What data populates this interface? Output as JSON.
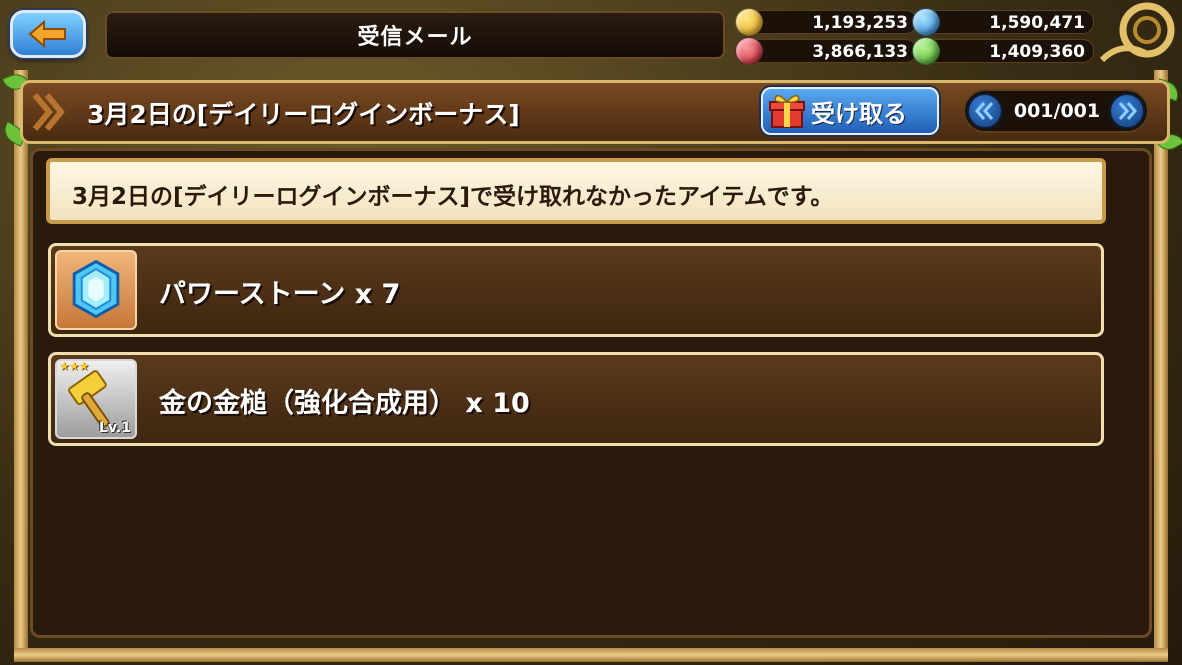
{
  "header": {
    "back_icon": "left-arrow-icon",
    "screen_title": "受信メール"
  },
  "currencies": [
    {
      "icon": "gold-coin-icon",
      "color": "#f2b722",
      "value": "1,193,253"
    },
    {
      "icon": "blue-stone-icon",
      "color": "#2f9be8",
      "value": "1,590,471"
    },
    {
      "icon": "red-orb-icon",
      "color": "#d63040",
      "value": "3,866,133"
    },
    {
      "icon": "green-orb-icon",
      "color": "#4cc030",
      "value": "1,409,360"
    }
  ],
  "mail": {
    "title": "3月2日の[デイリーログインボーナス]",
    "receive_label": "受け取る",
    "receive_icon": "gift-box-icon",
    "page_indicator": "001/001",
    "message": "3月2日の[デイリーログインボーナス]で受け取れなかったアイテムです。"
  },
  "items": [
    {
      "icon": "power-stone-icon",
      "label": "パワーストーン x 7"
    },
    {
      "icon": "gold-hammer-icon",
      "label": "金の金槌（強化合成用） x 10",
      "level": "Lv.1",
      "rarity": "★★★"
    }
  ],
  "colors": {
    "accent_blue": "#2f7fd4",
    "frame_gold": "#d7b86c",
    "panel_brown": "#2a1a0c"
  }
}
